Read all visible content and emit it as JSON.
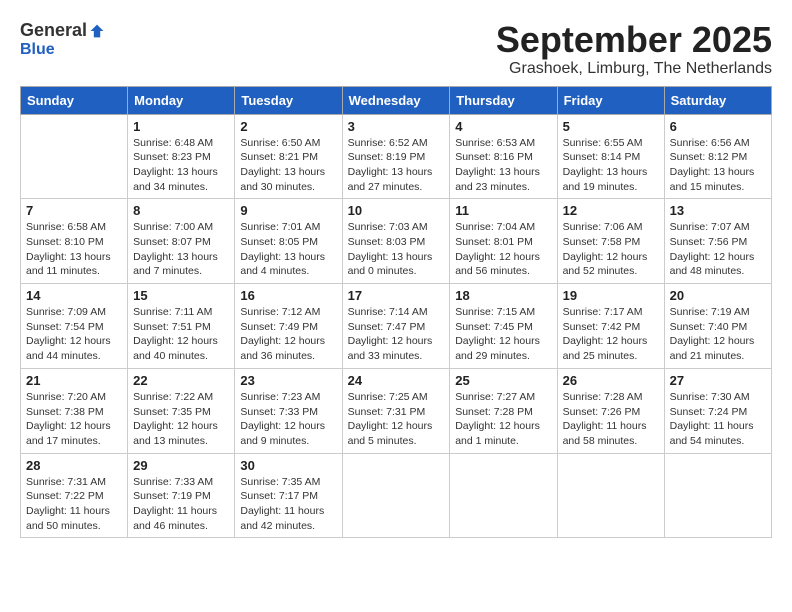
{
  "header": {
    "logo_general": "General",
    "logo_blue": "Blue",
    "month_title": "September 2025",
    "location": "Grashoek, Limburg, The Netherlands"
  },
  "days_of_week": [
    "Sunday",
    "Monday",
    "Tuesday",
    "Wednesday",
    "Thursday",
    "Friday",
    "Saturday"
  ],
  "weeks": [
    [
      {
        "day": "",
        "info": ""
      },
      {
        "day": "1",
        "info": "Sunrise: 6:48 AM\nSunset: 8:23 PM\nDaylight: 13 hours\nand 34 minutes."
      },
      {
        "day": "2",
        "info": "Sunrise: 6:50 AM\nSunset: 8:21 PM\nDaylight: 13 hours\nand 30 minutes."
      },
      {
        "day": "3",
        "info": "Sunrise: 6:52 AM\nSunset: 8:19 PM\nDaylight: 13 hours\nand 27 minutes."
      },
      {
        "day": "4",
        "info": "Sunrise: 6:53 AM\nSunset: 8:16 PM\nDaylight: 13 hours\nand 23 minutes."
      },
      {
        "day": "5",
        "info": "Sunrise: 6:55 AM\nSunset: 8:14 PM\nDaylight: 13 hours\nand 19 minutes."
      },
      {
        "day": "6",
        "info": "Sunrise: 6:56 AM\nSunset: 8:12 PM\nDaylight: 13 hours\nand 15 minutes."
      }
    ],
    [
      {
        "day": "7",
        "info": "Sunrise: 6:58 AM\nSunset: 8:10 PM\nDaylight: 13 hours\nand 11 minutes."
      },
      {
        "day": "8",
        "info": "Sunrise: 7:00 AM\nSunset: 8:07 PM\nDaylight: 13 hours\nand 7 minutes."
      },
      {
        "day": "9",
        "info": "Sunrise: 7:01 AM\nSunset: 8:05 PM\nDaylight: 13 hours\nand 4 minutes."
      },
      {
        "day": "10",
        "info": "Sunrise: 7:03 AM\nSunset: 8:03 PM\nDaylight: 13 hours\nand 0 minutes."
      },
      {
        "day": "11",
        "info": "Sunrise: 7:04 AM\nSunset: 8:01 PM\nDaylight: 12 hours\nand 56 minutes."
      },
      {
        "day": "12",
        "info": "Sunrise: 7:06 AM\nSunset: 7:58 PM\nDaylight: 12 hours\nand 52 minutes."
      },
      {
        "day": "13",
        "info": "Sunrise: 7:07 AM\nSunset: 7:56 PM\nDaylight: 12 hours\nand 48 minutes."
      }
    ],
    [
      {
        "day": "14",
        "info": "Sunrise: 7:09 AM\nSunset: 7:54 PM\nDaylight: 12 hours\nand 44 minutes."
      },
      {
        "day": "15",
        "info": "Sunrise: 7:11 AM\nSunset: 7:51 PM\nDaylight: 12 hours\nand 40 minutes."
      },
      {
        "day": "16",
        "info": "Sunrise: 7:12 AM\nSunset: 7:49 PM\nDaylight: 12 hours\nand 36 minutes."
      },
      {
        "day": "17",
        "info": "Sunrise: 7:14 AM\nSunset: 7:47 PM\nDaylight: 12 hours\nand 33 minutes."
      },
      {
        "day": "18",
        "info": "Sunrise: 7:15 AM\nSunset: 7:45 PM\nDaylight: 12 hours\nand 29 minutes."
      },
      {
        "day": "19",
        "info": "Sunrise: 7:17 AM\nSunset: 7:42 PM\nDaylight: 12 hours\nand 25 minutes."
      },
      {
        "day": "20",
        "info": "Sunrise: 7:19 AM\nSunset: 7:40 PM\nDaylight: 12 hours\nand 21 minutes."
      }
    ],
    [
      {
        "day": "21",
        "info": "Sunrise: 7:20 AM\nSunset: 7:38 PM\nDaylight: 12 hours\nand 17 minutes."
      },
      {
        "day": "22",
        "info": "Sunrise: 7:22 AM\nSunset: 7:35 PM\nDaylight: 12 hours\nand 13 minutes."
      },
      {
        "day": "23",
        "info": "Sunrise: 7:23 AM\nSunset: 7:33 PM\nDaylight: 12 hours\nand 9 minutes."
      },
      {
        "day": "24",
        "info": "Sunrise: 7:25 AM\nSunset: 7:31 PM\nDaylight: 12 hours\nand 5 minutes."
      },
      {
        "day": "25",
        "info": "Sunrise: 7:27 AM\nSunset: 7:28 PM\nDaylight: 12 hours\nand 1 minute."
      },
      {
        "day": "26",
        "info": "Sunrise: 7:28 AM\nSunset: 7:26 PM\nDaylight: 11 hours\nand 58 minutes."
      },
      {
        "day": "27",
        "info": "Sunrise: 7:30 AM\nSunset: 7:24 PM\nDaylight: 11 hours\nand 54 minutes."
      }
    ],
    [
      {
        "day": "28",
        "info": "Sunrise: 7:31 AM\nSunset: 7:22 PM\nDaylight: 11 hours\nand 50 minutes."
      },
      {
        "day": "29",
        "info": "Sunrise: 7:33 AM\nSunset: 7:19 PM\nDaylight: 11 hours\nand 46 minutes."
      },
      {
        "day": "30",
        "info": "Sunrise: 7:35 AM\nSunset: 7:17 PM\nDaylight: 11 hours\nand 42 minutes."
      },
      {
        "day": "",
        "info": ""
      },
      {
        "day": "",
        "info": ""
      },
      {
        "day": "",
        "info": ""
      },
      {
        "day": "",
        "info": ""
      }
    ]
  ]
}
